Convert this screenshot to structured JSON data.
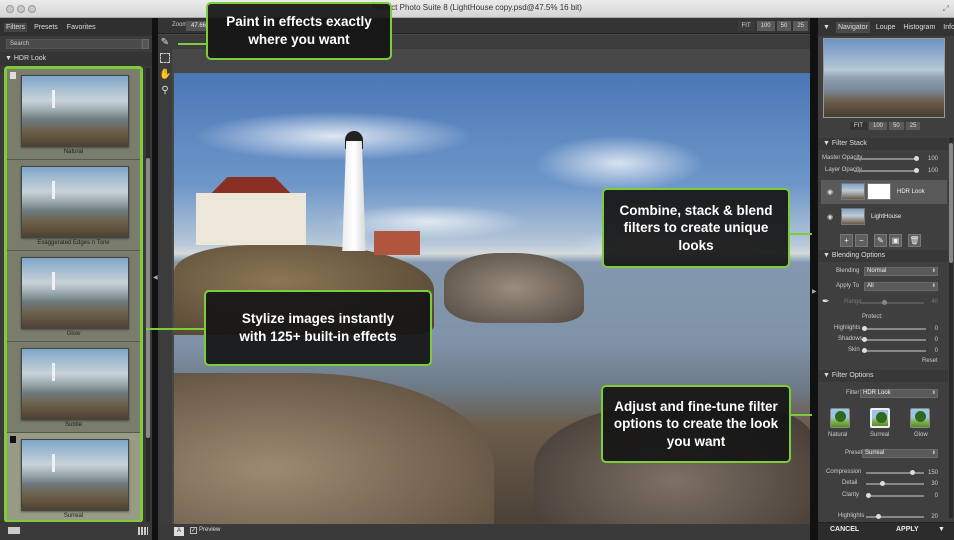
{
  "window": {
    "title": "Perfect Photo Suite 8 (LightHouse copy.psd@47.5% 16 bit)",
    "buttons": [
      "close",
      "minimize",
      "zoom"
    ]
  },
  "left_panel": {
    "tabs": [
      {
        "label": "Filters",
        "active": true
      },
      {
        "label": "Presets",
        "active": false
      },
      {
        "label": "Favorites",
        "active": false
      }
    ],
    "search_placeholder": "Search",
    "section": "▼ HDR Look",
    "presets": [
      {
        "label": "Natural",
        "flag": "light",
        "selected": false
      },
      {
        "label": "Exaggerated Edges n Tone",
        "flag": "",
        "selected": false
      },
      {
        "label": "Glow",
        "flag": "",
        "selected": false
      },
      {
        "label": "Subtle",
        "flag": "",
        "selected": false
      },
      {
        "label": "Surreal",
        "flag": "dark",
        "selected": true
      }
    ]
  },
  "center": {
    "zoom_label": "Zoom",
    "zoom_value": "47.66",
    "fit_buttons": [
      {
        "label": "FIT",
        "active": true
      },
      {
        "label": "100",
        "active": false
      },
      {
        "label": "50",
        "active": false
      },
      {
        "label": "25",
        "active": false
      }
    ],
    "tools": [
      "brush-icon",
      "crop-icon",
      "hand-icon",
      "zoom-icon"
    ],
    "bottom": {
      "a_label": "A",
      "preview_label": "Preview",
      "preview_checked": true
    }
  },
  "callouts": {
    "paint": "Paint in effects exactly where you want",
    "stylize": "Stylize images instantly with 125+ built-in effects",
    "combine": "Combine, stack & blend filters to create unique looks",
    "adjust": "Adjust and fine-tune filter options to create the look you want",
    "accent_color": "#7fcc3a"
  },
  "right_panel": {
    "tabs": [
      {
        "label": "Navigator",
        "active": true
      },
      {
        "label": "Loupe",
        "active": false
      },
      {
        "label": "Histogram",
        "active": false
      },
      {
        "label": "Info",
        "active": false
      }
    ],
    "nav_buttons": [
      {
        "label": "FIT",
        "active": true
      },
      {
        "label": "100",
        "active": false
      },
      {
        "label": "50",
        "active": false
      },
      {
        "label": "25",
        "active": false
      }
    ],
    "filter_stack": {
      "title": "▼ Filter Stack",
      "master_opacity_label": "Master Opacity",
      "master_opacity": "100",
      "layer_opacity_label": "Layer Opacity",
      "layer_opacity": "100",
      "layers": [
        {
          "name": "HDR Look",
          "selected": true
        },
        {
          "name": "LightHouse",
          "selected": false
        }
      ]
    },
    "blending": {
      "title": "▼ Blending Options",
      "blending_label": "Blending",
      "blending_value": "Normal",
      "apply_to_label": "Apply To",
      "apply_to_value": "All",
      "range_label": "Range",
      "range_value": "40",
      "protect_label": "Protect:",
      "highlights_label": "Highlights",
      "highlights": "0",
      "shadows_label": "Shadows",
      "shadows": "0",
      "skin_label": "Skin",
      "skin": "0",
      "reset_label": "Reset"
    },
    "filter_options": {
      "title": "▼ Filter Options",
      "filter_label": "Filter",
      "filter_value": "HDR Look",
      "styles": [
        {
          "label": "Natural",
          "selected": false
        },
        {
          "label": "Surreal",
          "selected": true
        },
        {
          "label": "Glow",
          "selected": false
        }
      ],
      "preset_label": "Preset",
      "preset_value": "Surreal",
      "compression_label": "Compression",
      "compression": "150",
      "detail_label": "Detail",
      "detail": "30",
      "clarity_label": "Clarity",
      "clarity": "0",
      "highlights_label": "Highlights",
      "highlights": "20"
    },
    "cancel_label": "CANCEL",
    "apply_label": "APPLY"
  }
}
